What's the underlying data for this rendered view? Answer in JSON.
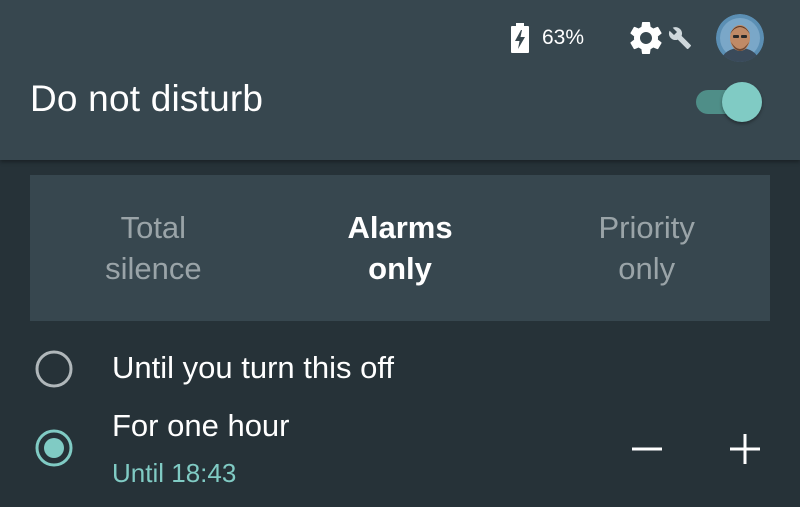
{
  "status_bar": {
    "battery_icon": "battery-charging-icon",
    "battery_percent": "63%",
    "settings_icon": "gear-icon",
    "edit_icon": "wrench-icon",
    "avatar": "user-avatar"
  },
  "header": {
    "title": "Do not disturb",
    "toggle_on": true
  },
  "modes": [
    {
      "label_line1": "Total",
      "label_line2": "silence",
      "selected": false
    },
    {
      "label_line1": "Alarms",
      "label_line2": "only",
      "selected": true
    },
    {
      "label_line1": "Priority",
      "label_line2": "only",
      "selected": false
    }
  ],
  "duration_options": [
    {
      "label": "Until you turn this off",
      "selected": false
    },
    {
      "label": "For one hour",
      "sublabel": "Until 18:43",
      "selected": true
    }
  ],
  "stepper": {
    "decrease_icon": "minus-icon",
    "increase_icon": "plus-icon"
  },
  "colors": {
    "background": "#263238",
    "header": "#37474f",
    "accent": "#80cbc4",
    "inactive_text": "#9aa4a8"
  }
}
